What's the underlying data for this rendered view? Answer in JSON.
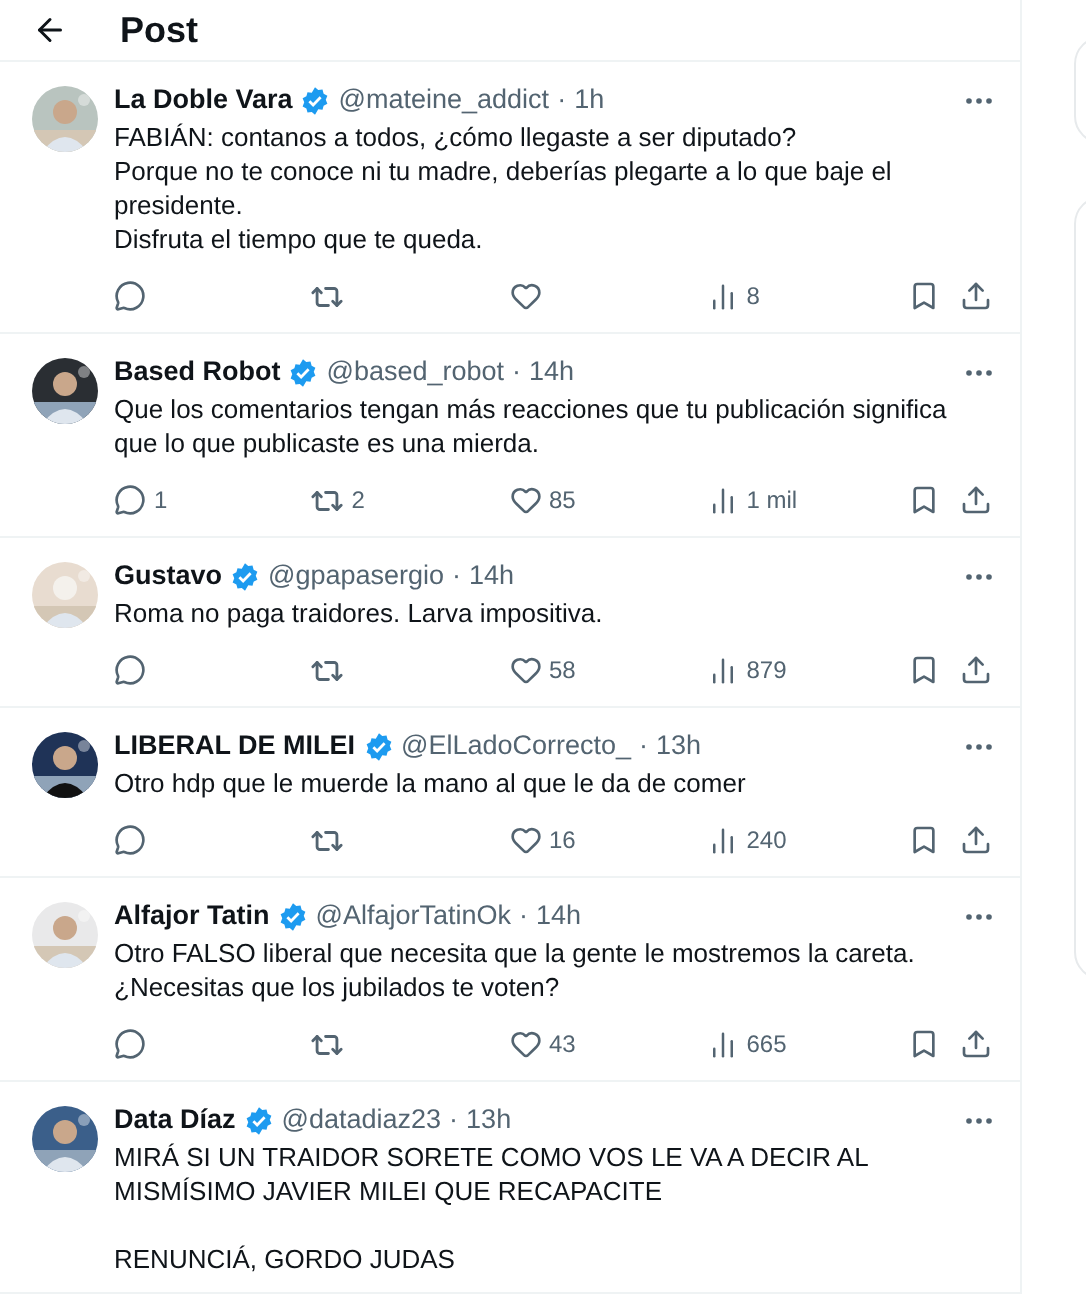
{
  "header": {
    "title": "Post"
  },
  "replies": [
    {
      "name": "La Doble Vara",
      "verified": true,
      "handle": "@mateine_addict",
      "separator": "·",
      "time": "1h",
      "text": "FABIÁN: contanos a todos, ¿cómo llegaste a ser diputado?\nPorque no te conoce ni tu madre, deberías plegarte a lo que baje el presidente.\nDisfruta el tiempo que te queda.",
      "views": "8"
    },
    {
      "name": "Based Robot",
      "verified": true,
      "handle": "@based_robot",
      "separator": "·",
      "time": "14h",
      "text": "Que los comentarios tengan más reacciones que tu publicación significa que lo que publicaste es una mierda.",
      "replies": "1",
      "reposts": "2",
      "likes": "85",
      "views": "1 mil"
    },
    {
      "name": "Gustavo",
      "verified": true,
      "handle": "@gpapasergio",
      "separator": "·",
      "time": "14h",
      "text": "Roma no paga traidores. Larva impositiva.",
      "likes": "58",
      "views": "879"
    },
    {
      "name": "LIBERAL DE MILEI",
      "verified": true,
      "handle": "@ElLadoCorrecto_",
      "separator": "·",
      "time": "13h",
      "text": "Otro hdp que le muerde la mano al que le da de comer",
      "likes": "16",
      "views": "240"
    },
    {
      "name": "Alfajor Tatin",
      "verified": true,
      "handle": "@AlfajorTatinOk",
      "separator": "·",
      "time": "14h",
      "text": "Otro FALSO liberal que necesita que la gente le mostremos la careta.\n¿Necesitas que los jubilados te voten?",
      "likes": "43",
      "views": "665"
    },
    {
      "name": "Data Díaz",
      "verified": true,
      "handle": "@datadiaz23",
      "separator": "·",
      "time": "13h",
      "text": "MIRÁ SI UN TRAIDOR SORETE COMO VOS LE VA A DECIR AL MISMÍSIMO JAVIER MILEI QUE RECAPACITE\n\nRENUNCIÁ, GORDO JUDAS"
    }
  ]
}
